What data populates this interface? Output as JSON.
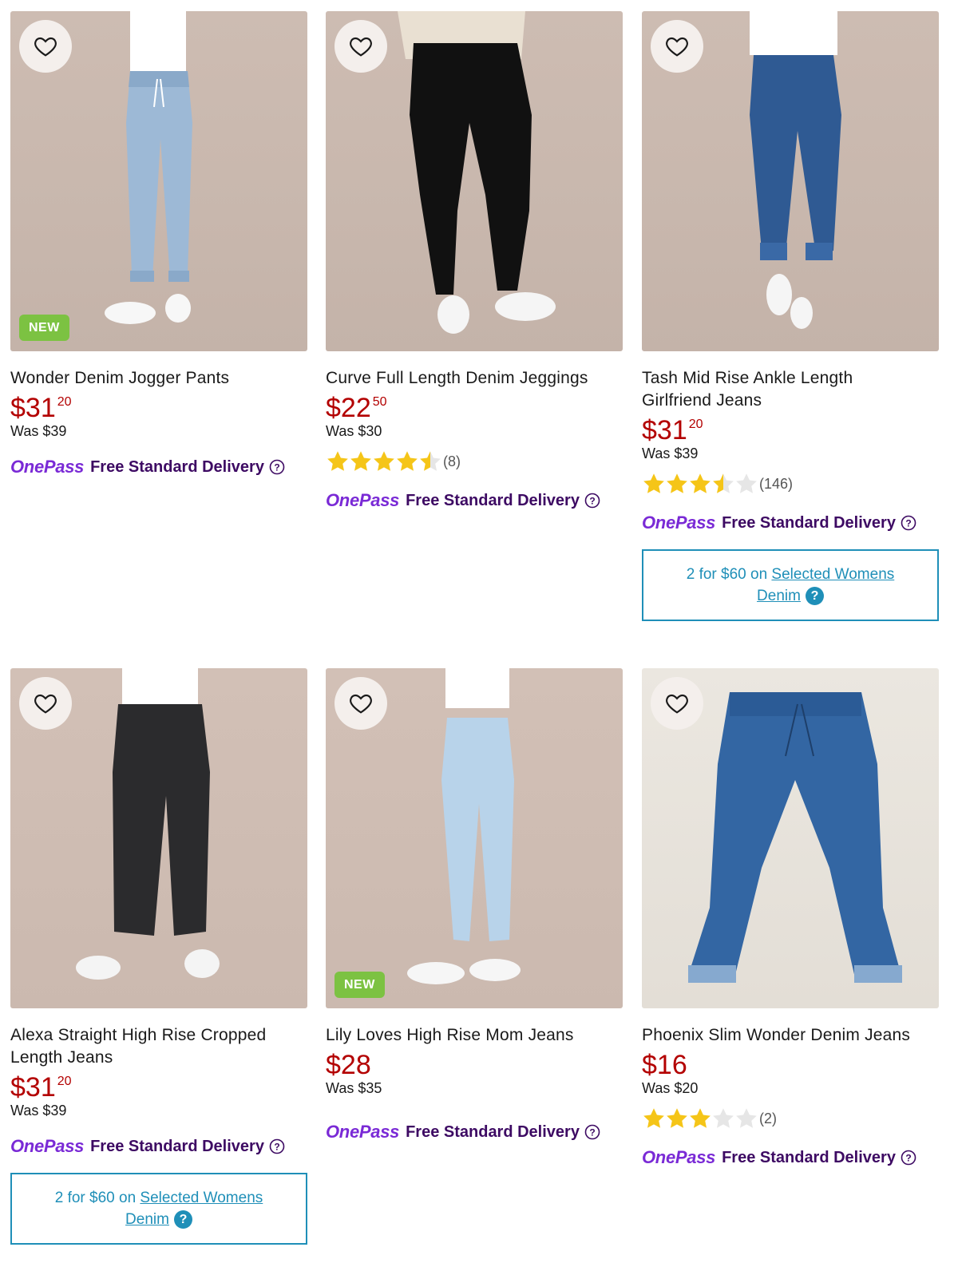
{
  "products": [
    {
      "title": "Wonder Denim Jogger Pants",
      "price_dollars": "$31",
      "price_cents": "20",
      "was": "Was $39",
      "badge": "NEW",
      "rating": null,
      "review_count": null,
      "onepass": {
        "logo": "OnePass",
        "delivery": "Free Standard Delivery"
      },
      "promo": null
    },
    {
      "title": "Curve Full Length Denim Jeggings",
      "price_dollars": "$22",
      "price_cents": "50",
      "was": "Was $30",
      "badge": null,
      "rating": 4.5,
      "review_count": "(8)",
      "onepass": {
        "logo": "OnePass",
        "delivery": "Free Standard Delivery"
      },
      "promo": null
    },
    {
      "title": "Tash Mid Rise Ankle Length Girlfriend Jeans",
      "price_dollars": "$31",
      "price_cents": "20",
      "was": "Was $39",
      "badge": null,
      "rating": 3.5,
      "review_count": "(146)",
      "onepass": {
        "logo": "OnePass",
        "delivery": "Free Standard Delivery"
      },
      "promo": {
        "text": "2 for $60 on",
        "link": "Selected Womens Denim",
        "icon": "question-icon"
      }
    },
    {
      "title": "Alexa Straight High Rise Cropped Length Jeans",
      "price_dollars": "$31",
      "price_cents": "20",
      "was": "Was $39",
      "badge": null,
      "rating": null,
      "review_count": null,
      "onepass": {
        "logo": "OnePass",
        "delivery": "Free Standard Delivery"
      },
      "promo": {
        "text": "2 for $60 on",
        "link": "Selected Womens Denim",
        "icon": "question-icon"
      }
    },
    {
      "title": "Lily Loves High Rise Mom Jeans",
      "price_dollars": "$28",
      "price_cents": "",
      "was": "Was $35",
      "badge": "NEW",
      "rating": null,
      "review_count": null,
      "onepass": {
        "logo": "OnePass",
        "delivery": "Free Standard Delivery"
      },
      "promo": null
    },
    {
      "title": "Phoenix Slim Wonder Denim Jeans",
      "price_dollars": "$16",
      "price_cents": "",
      "was": "Was $20",
      "badge": null,
      "rating": 3,
      "review_count": "(2)",
      "onepass": {
        "logo": "OnePass",
        "delivery": "Free Standard Delivery"
      },
      "promo": null
    }
  ],
  "colors": {
    "price": "#b30000",
    "onepass_logo": "#7a2ad6",
    "onepass_delivery": "#3d0a63",
    "promo": "#1f8fb8",
    "badge_new": "#7cc242",
    "star": "#f5c518"
  },
  "icons": {
    "favourite": "heart-outline-icon",
    "help": "question-circle-icon",
    "star": "star-icon"
  }
}
